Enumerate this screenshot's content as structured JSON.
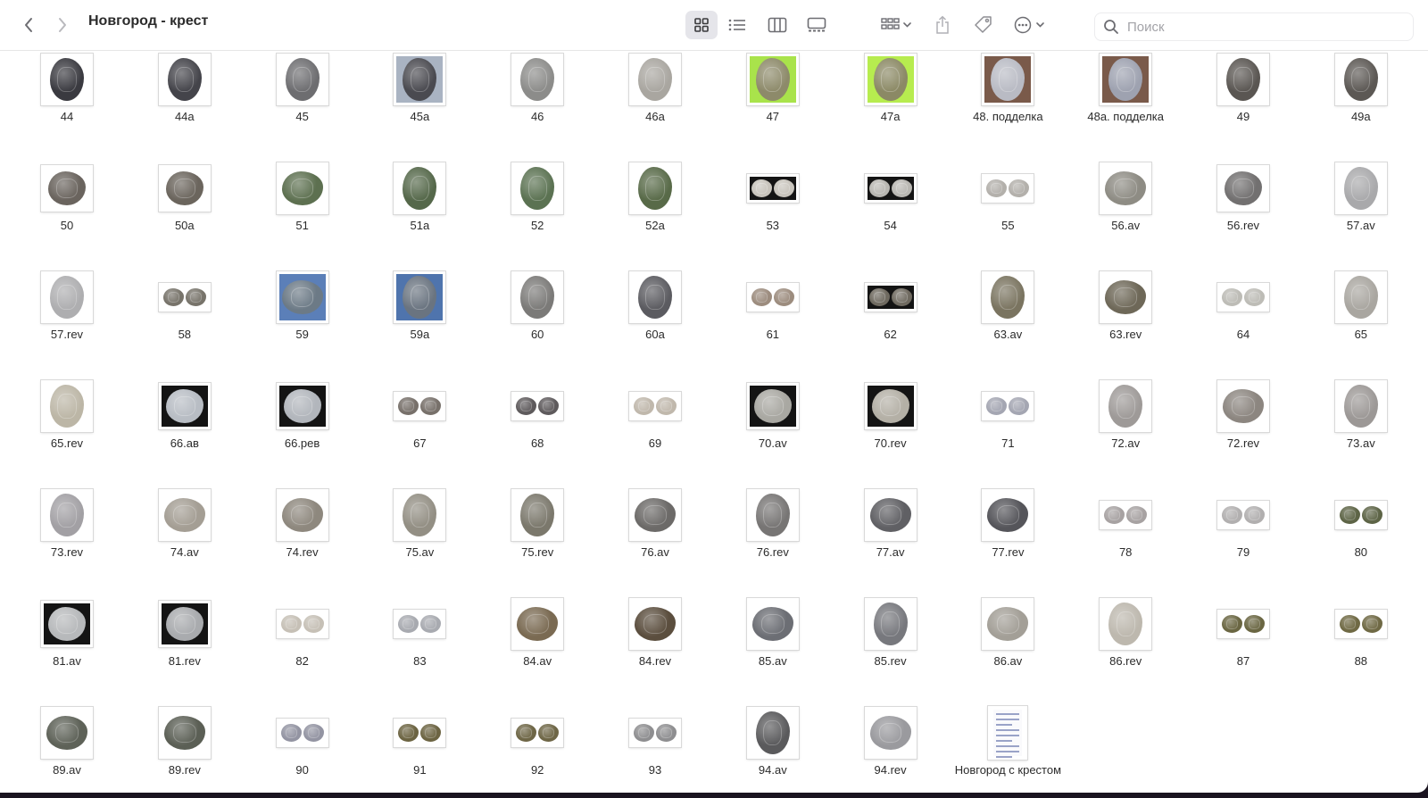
{
  "window": {
    "title": "Новгород - крест"
  },
  "toolbar": {
    "back": "chevron-left-icon",
    "forward": "chevron-right-icon",
    "views": [
      "grid-view-icon",
      "list-view-icon",
      "column-view-icon",
      "gallery-view-icon"
    ],
    "active_view": "grid-view-icon",
    "group": "group-icon",
    "share": "share-icon",
    "tag": "tag-icon",
    "more": "ellipsis-icon"
  },
  "search": {
    "placeholder": "Поиск"
  },
  "files": [
    {
      "label": "44",
      "bg": "#ffffff",
      "coin": "#3a3a40",
      "style": "single",
      "tall": true
    },
    {
      "label": "44a",
      "bg": "#ffffff",
      "coin": "#44444a",
      "style": "single",
      "tall": true
    },
    {
      "label": "45",
      "bg": "#ffffff",
      "coin": "#6d6d70",
      "style": "single",
      "tall": true
    },
    {
      "label": "45a",
      "bg": "#a9b3c2",
      "coin": "#4a4a50",
      "style": "single",
      "tall": true
    },
    {
      "label": "46",
      "bg": "#ffffff",
      "coin": "#8c8c8a",
      "style": "single",
      "tall": true
    },
    {
      "label": "46a",
      "bg": "#ffffff",
      "coin": "#a9a6a0",
      "style": "single",
      "tall": true
    },
    {
      "label": "47",
      "bg": "#a9e34b",
      "coin": "#8d8a6a",
      "style": "single",
      "tall": true
    },
    {
      "label": "47a",
      "bg": "#b7ec4f",
      "coin": "#8b8965",
      "style": "single",
      "tall": true
    },
    {
      "label": "48. подделка",
      "bg": "#7a5a4a",
      "coin": "#b9bbc4",
      "style": "single",
      "tall": true
    },
    {
      "label": "48a. подделка",
      "bg": "#7a5a4a",
      "coin": "#9ea2b0",
      "style": "single",
      "tall": true
    },
    {
      "label": "49",
      "bg": "#ffffff",
      "coin": "#5a5652",
      "style": "single",
      "tall": true
    },
    {
      "label": "49a",
      "bg": "#ffffff",
      "coin": "#5c5854",
      "style": "single",
      "tall": true
    },
    {
      "label": "50",
      "bg": "#ffffff",
      "coin": "#6a645e",
      "style": "square"
    },
    {
      "label": "50a",
      "bg": "#ffffff",
      "coin": "#6b655d",
      "style": "square"
    },
    {
      "label": "51",
      "bg": "#ffffff",
      "coin": "#5d7050",
      "style": "single"
    },
    {
      "label": "51a",
      "bg": "#ffffff",
      "coin": "#55684a",
      "style": "single",
      "tall": true
    },
    {
      "label": "52",
      "bg": "#ffffff",
      "coin": "#5b7252",
      "style": "single",
      "tall": true
    },
    {
      "label": "52a",
      "bg": "#ffffff",
      "coin": "#586a48",
      "style": "single",
      "tall": true
    },
    {
      "label": "53",
      "bg": "#141414",
      "coin": "#c8c4bc",
      "style": "pair"
    },
    {
      "label": "54",
      "bg": "#141414",
      "coin": "#b9b7b2",
      "style": "pair"
    },
    {
      "label": "55",
      "bg": "#ffffff",
      "coin": "#b3b0ab",
      "style": "pair"
    },
    {
      "label": "56.av",
      "bg": "#ffffff",
      "coin": "#8e8c84",
      "style": "single"
    },
    {
      "label": "56.rev",
      "bg": "#ffffff",
      "coin": "#727070",
      "style": "square"
    },
    {
      "label": "57.av",
      "bg": "#ffffff",
      "coin": "#a9a9ab",
      "style": "single",
      "tall": true
    },
    {
      "label": "57.rev",
      "bg": "#ffffff",
      "coin": "#aeaeb0",
      "style": "single",
      "tall": true
    },
    {
      "label": "58",
      "bg": "#ffffff",
      "coin": "#77736a",
      "style": "pair"
    },
    {
      "label": "59",
      "bg": "#5b7fb8",
      "coin": "#6c7a86",
      "style": "single"
    },
    {
      "label": "59a",
      "bg": "#4f74ad",
      "coin": "#6a7480",
      "style": "single",
      "tall": true
    },
    {
      "label": "60",
      "bg": "#ffffff",
      "coin": "#7b7a78",
      "style": "single",
      "tall": true
    },
    {
      "label": "60a",
      "bg": "#ffffff",
      "coin": "#5b5b60",
      "style": "single",
      "tall": true
    },
    {
      "label": "61",
      "bg": "#ffffff",
      "coin": "#9c8c7e",
      "style": "pair"
    },
    {
      "label": "62",
      "bg": "#141414",
      "coin": "#6f6a60",
      "style": "pair"
    },
    {
      "label": "63.av",
      "bg": "#ffffff",
      "coin": "#7a7460",
      "style": "single",
      "tall": true
    },
    {
      "label": "63.rev",
      "bg": "#ffffff",
      "coin": "#6e6858",
      "style": "single"
    },
    {
      "label": "64",
      "bg": "#ffffff",
      "coin": "#bdbcb6",
      "style": "pair"
    },
    {
      "label": "65",
      "bg": "#ffffff",
      "coin": "#a9a6a0",
      "style": "single",
      "tall": true
    },
    {
      "label": "65.rev",
      "bg": "#ffffff",
      "coin": "#bcb6a6",
      "style": "single",
      "tall": true
    },
    {
      "label": "66.ав",
      "bg": "#141414",
      "coin": "#b8bdc4",
      "style": "square"
    },
    {
      "label": "66.рев",
      "bg": "#141414",
      "coin": "#b2b6bc",
      "style": "square"
    },
    {
      "label": "67",
      "bg": "#ffffff",
      "coin": "#77706a",
      "style": "pair"
    },
    {
      "label": "68",
      "bg": "#ffffff",
      "coin": "#5e5a5c",
      "style": "pair"
    },
    {
      "label": "69",
      "bg": "#ffffff",
      "coin": "#c0b8ac",
      "style": "pair"
    },
    {
      "label": "70.av",
      "bg": "#141414",
      "coin": "#a9a8a2",
      "style": "square"
    },
    {
      "label": "70.rev",
      "bg": "#141414",
      "coin": "#b4b0a6",
      "style": "square"
    },
    {
      "label": "71",
      "bg": "#ffffff",
      "coin": "#a4a6b2",
      "style": "pair"
    },
    {
      "label": "72.av",
      "bg": "#ffffff",
      "coin": "#9e9a98",
      "style": "single",
      "tall": true
    },
    {
      "label": "72.rev",
      "bg": "#ffffff",
      "coin": "#8c8680",
      "style": "single"
    },
    {
      "label": "73.av",
      "bg": "#ffffff",
      "coin": "#9c9896",
      "style": "single",
      "tall": true
    },
    {
      "label": "73.rev",
      "bg": "#ffffff",
      "coin": "#a2a0a4",
      "style": "single",
      "tall": true
    },
    {
      "label": "74.av",
      "bg": "#ffffff",
      "coin": "#a49e94",
      "style": "single"
    },
    {
      "label": "74.rev",
      "bg": "#ffffff",
      "coin": "#8e887e",
      "style": "single"
    },
    {
      "label": "75.av",
      "bg": "#ffffff",
      "coin": "#938f84",
      "style": "single",
      "tall": true
    },
    {
      "label": "75.rev",
      "bg": "#ffffff",
      "coin": "#7b786c",
      "style": "single",
      "tall": true
    },
    {
      "label": "76.av",
      "bg": "#ffffff",
      "coin": "#6c6a68",
      "style": "single"
    },
    {
      "label": "76.rev",
      "bg": "#ffffff",
      "coin": "#777574",
      "style": "single",
      "tall": true
    },
    {
      "label": "77.av",
      "bg": "#ffffff",
      "coin": "#606064",
      "style": "single"
    },
    {
      "label": "77.rev",
      "bg": "#ffffff",
      "coin": "#55555a",
      "style": "single"
    },
    {
      "label": "78",
      "bg": "#ffffff",
      "coin": "#a7a2a2",
      "style": "pair"
    },
    {
      "label": "79",
      "bg": "#ffffff",
      "coin": "#b1afaf",
      "style": "pair"
    },
    {
      "label": "80",
      "bg": "#ffffff",
      "coin": "#5d6446",
      "style": "pair"
    },
    {
      "label": "81.av",
      "bg": "#141414",
      "coin": "#b7b9bb",
      "style": "square"
    },
    {
      "label": "81.rev",
      "bg": "#141414",
      "coin": "#a9abae",
      "style": "square"
    },
    {
      "label": "82",
      "bg": "#ffffff",
      "coin": "#c6c0b6",
      "style": "pair"
    },
    {
      "label": "83",
      "bg": "#ffffff",
      "coin": "#a8aab0",
      "style": "pair"
    },
    {
      "label": "84.av",
      "bg": "#ffffff",
      "coin": "#7a6a52",
      "style": "single"
    },
    {
      "label": "84.rev",
      "bg": "#ffffff",
      "coin": "#5b4e3e",
      "style": "single"
    },
    {
      "label": "85.av",
      "bg": "#ffffff",
      "coin": "#6c6e74",
      "style": "single"
    },
    {
      "label": "85.rev",
      "bg": "#ffffff",
      "coin": "#77787d",
      "style": "single",
      "tall": true
    },
    {
      "label": "86.av",
      "bg": "#ffffff",
      "coin": "#a39f97",
      "style": "single"
    },
    {
      "label": "86.rev",
      "bg": "#ffffff",
      "coin": "#bdb8ae",
      "style": "single",
      "tall": true
    },
    {
      "label": "87",
      "bg": "#ffffff",
      "coin": "#6a6642",
      "style": "pair"
    },
    {
      "label": "88",
      "bg": "#ffffff",
      "coin": "#6f6944",
      "style": "pair"
    },
    {
      "label": "89.av",
      "bg": "#ffffff",
      "coin": "#5e6258",
      "style": "single"
    },
    {
      "label": "89.rev",
      "bg": "#ffffff",
      "coin": "#5b5f55",
      "style": "single"
    },
    {
      "label": "90",
      "bg": "#ffffff",
      "coin": "#9394a2",
      "style": "pair"
    },
    {
      "label": "91",
      "bg": "#ffffff",
      "coin": "#6c6442",
      "style": "pair"
    },
    {
      "label": "92",
      "bg": "#ffffff",
      "coin": "#6e6646",
      "style": "pair"
    },
    {
      "label": "93",
      "bg": "#ffffff",
      "coin": "#8e8e90",
      "style": "pair"
    },
    {
      "label": "94.av",
      "bg": "#ffffff",
      "coin": "#5a5a5c",
      "style": "single",
      "tall": true
    },
    {
      "label": "94.rev",
      "bg": "#ffffff",
      "coin": "#9a9a9e",
      "style": "single"
    },
    {
      "label": "Новгород с крестом",
      "style": "document"
    }
  ]
}
